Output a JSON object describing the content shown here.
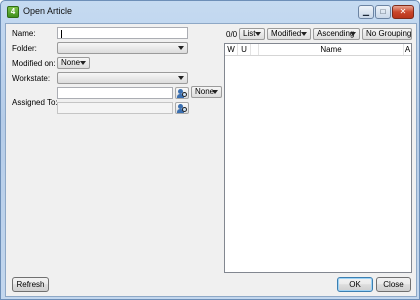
{
  "window": {
    "title": "Open Article",
    "app_icon_glyph": "4",
    "controls": {
      "minimize": "▁",
      "maximize": "□",
      "close": "✕"
    }
  },
  "form": {
    "name_label": "Name:",
    "name_value": "",
    "folder_label": "Folder:",
    "folder_value": "",
    "modified_label": "Modified on:",
    "modified_value": "None",
    "workstate_label": "Workstate:",
    "workstate_value": "",
    "assigned_label": "Assigned To:",
    "assigned_value_1": "",
    "assigned_value_2": "",
    "assigned_mode_value": "None"
  },
  "toolbar": {
    "count": "0/0",
    "view_value": "List",
    "sort_field_value": "Modified",
    "sort_order_value": "Ascending",
    "grouping_value": "No Grouping"
  },
  "grid": {
    "columns": [
      "W",
      "U",
      "Name",
      "A"
    ],
    "rows": []
  },
  "buttons": {
    "refresh": "Refresh",
    "ok": "OK",
    "close": "Close"
  },
  "icons": [
    "app-icon",
    "minimize-icon",
    "maximize-icon",
    "close-icon",
    "dropdown-arrow-icon",
    "user-picker-icon"
  ]
}
